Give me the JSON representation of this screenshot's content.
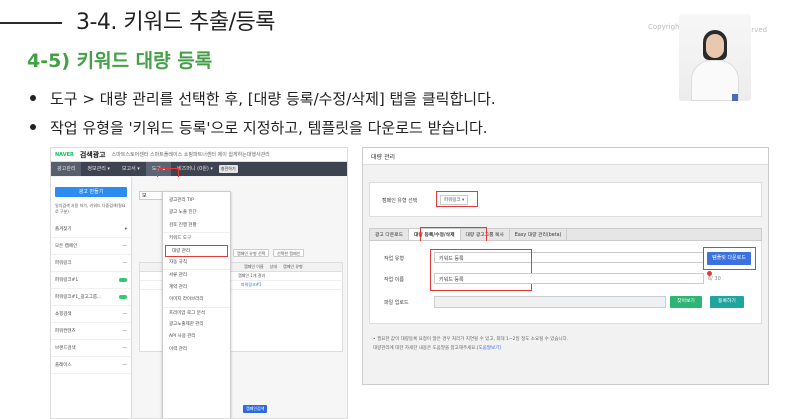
{
  "slide": {
    "title": "3-4. 키워드 추출/등록",
    "subtitle": "4-5) 키워드 대량 등록",
    "copyright_fragment": "Copyrigh",
    "reserved_fragment": "erved",
    "bullets": [
      "도구 > 대량 관리를 선택한 후, [대량 등록/수정/삭제] 탭을 클릭합니다.",
      "작업 유형을 '키워드 등록'으로 지정하고, 템플릿을 다운로드 받습니다."
    ]
  },
  "left_shot": {
    "naver_logo": "NAVER",
    "brand": "검색광고",
    "top_links": "스마트스토어센터  스마트플레이스  쇼핑파트너센터  제이  쉽게하는대행사관리",
    "nav": [
      "광고관리",
      "정보관리 ▾",
      "보고서 ▾",
      "도구 ▴",
      "비즈머니 (0원) ▾"
    ],
    "nav_badge": "충전하기",
    "sidebar_button": "광고 만들기",
    "sidebar_check": "일치검색 사용 허가, 키워드 다중검색(필요로 구분)",
    "sidebar_items": [
      {
        "label": "즐겨찾기",
        "marker": "▾"
      },
      {
        "label": "모든 캠페인",
        "marker": "—"
      },
      {
        "label": "파워링크",
        "marker": "—"
      },
      {
        "label": "파워링크#1",
        "marker": ""
      },
      {
        "label": "파워링크#1_광고그룹...",
        "marker": ""
      },
      {
        "label": "쇼핑검색",
        "marker": "—"
      },
      {
        "label": "파워컨텐츠",
        "marker": "—"
      },
      {
        "label": "브랜드검색",
        "marker": "—"
      },
      {
        "label": "플레이스",
        "marker": "—"
      }
    ],
    "search_text": "모",
    "table_headers": [
      "",
      "캠페인 이름",
      "상태",
      "캠페인 유형"
    ],
    "table_rows": [
      "캠페인 1개 결과",
      "파워링크#1"
    ],
    "filter_buttons": [
      "캠페인 유형 선택",
      "선택한 캠페인"
    ],
    "bottom_button": "캠페인검색"
  },
  "dropdown": {
    "items": [
      "광고관리 TIP",
      "광고 노출 진단",
      "검토 진행 현황",
      "키워드 도구",
      "대량 관리",
      "자동 규칙",
      "서류 관리",
      "계약 관리",
      "이미지 라이브러리",
      "프리미엄 로그 분석",
      "광고노출제한 관리",
      "API 사용 관리",
      "이력 관리"
    ],
    "highlighted_index": 4
  },
  "right_shot": {
    "title": "대량 관리",
    "campaign_type_label": "캠페인 유형 선택",
    "campaign_type_value": "파워링크 ▾",
    "tabs": [
      "광고 다운로드",
      "대량 등록/수정/삭제",
      "대량 광고그룹 복사",
      "Easy 대량 관리(beta)"
    ],
    "active_tab_index": 1,
    "work_type_label": "작업 유형",
    "work_type_value": "키워드 등록",
    "job_name_label": "작업 이름",
    "job_name_value": "키워드 등록",
    "job_name_counter": "6/ 30",
    "upload_label": "파일 업로드",
    "template_download": "템플릿 다운로드",
    "browse_button": "찾아보기",
    "register_button": "등록하기",
    "note1": "• 필요한 값이 대량등록 요청이 많은 경우 처리가 지연될 수 있고, 최대 1~2일 정도 소요될 수 있습니다.",
    "note2": "대량관리에 대한 자세한 내용은 도움말을 참고해주세요.",
    "help_link": "[도움말보기]"
  },
  "colors": {
    "subtitle_green": "#43a047",
    "highlight_red": "#e53935",
    "nav_dark": "#3d4350",
    "primary_blue": "#3b72e0"
  }
}
